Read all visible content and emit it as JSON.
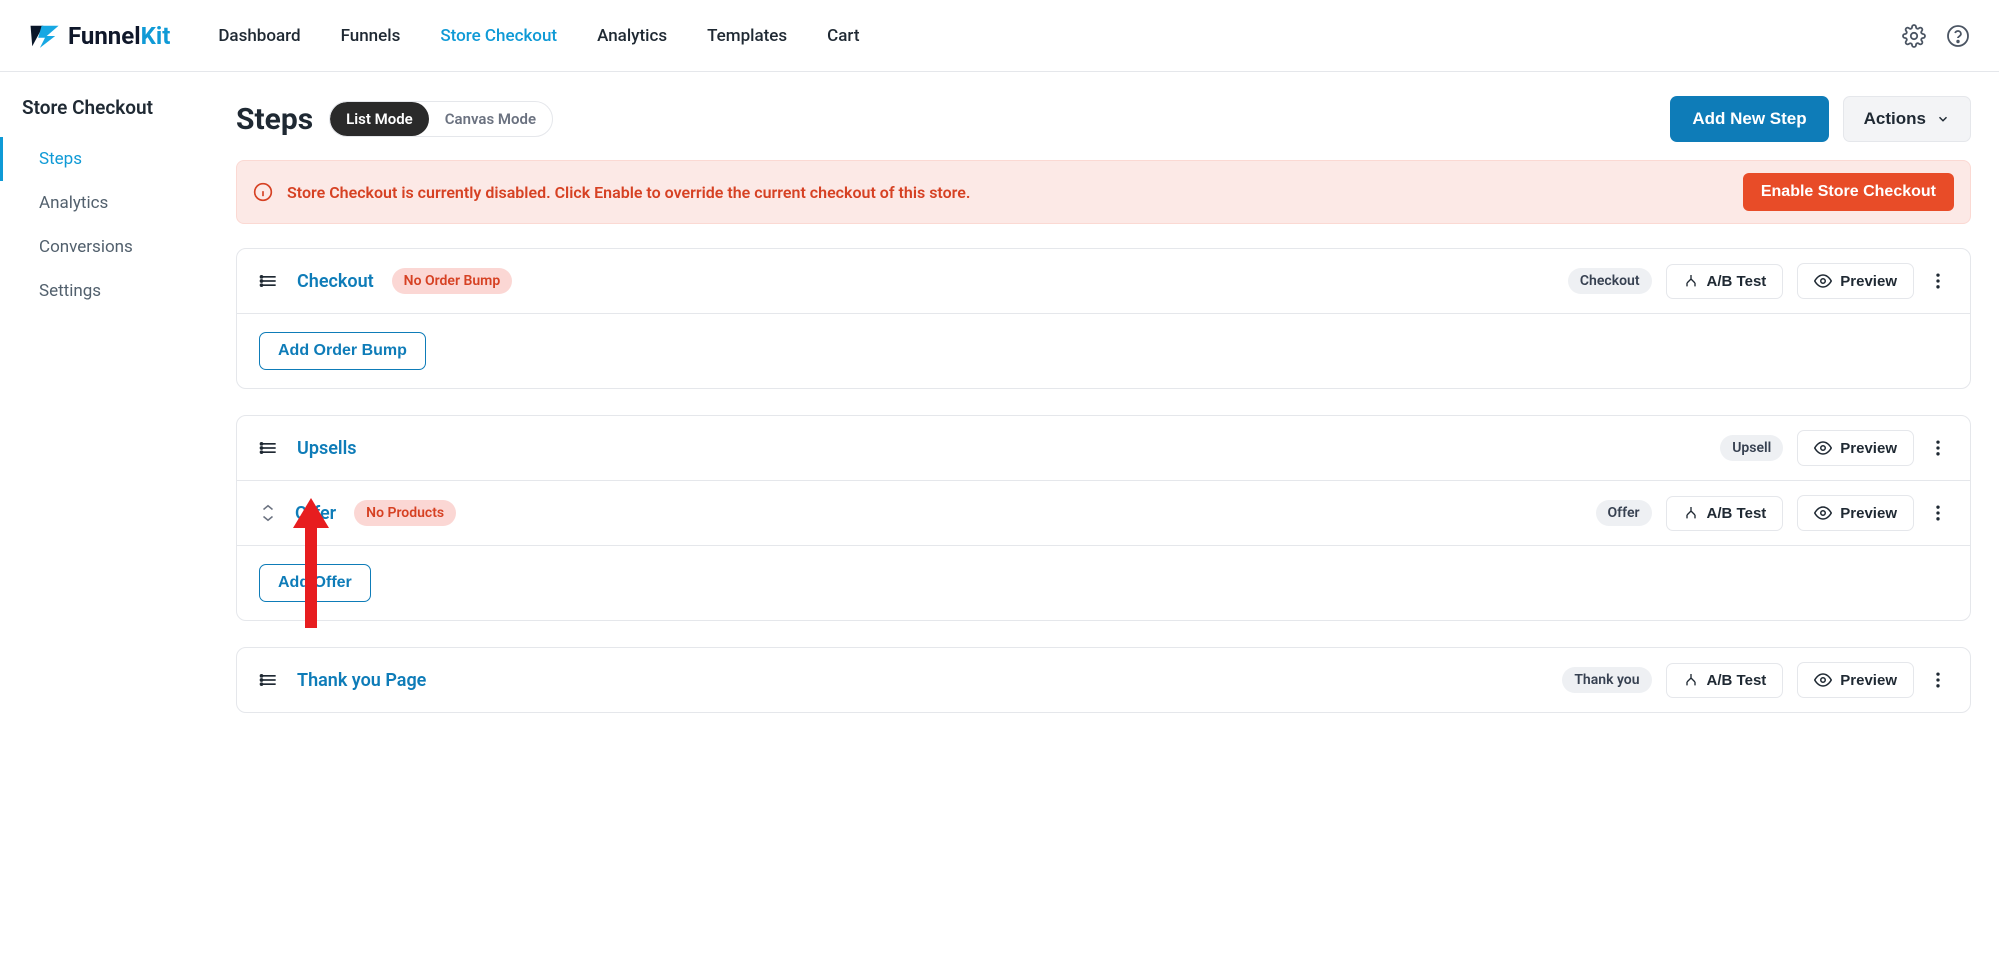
{
  "logo": {
    "prefix": "Funnel",
    "suffix": "Kit"
  },
  "topnav": {
    "dashboard": "Dashboard",
    "funnels": "Funnels",
    "storecheckout": "Store Checkout",
    "analytics": "Analytics",
    "templates": "Templates",
    "cart": "Cart"
  },
  "sidebar": {
    "title": "Store Checkout",
    "items": [
      "Steps",
      "Analytics",
      "Conversions",
      "Settings"
    ]
  },
  "page": {
    "title": "Steps",
    "mode_list": "List Mode",
    "mode_canvas": "Canvas Mode",
    "add_new_step": "Add New Step",
    "actions": "Actions"
  },
  "alert": {
    "text": "Store Checkout is currently disabled. Click Enable to override the current checkout of this store.",
    "button": "Enable Store Checkout"
  },
  "step1": {
    "name": "Checkout",
    "badge": "No Order Bump",
    "type_pill": "Checkout",
    "ab_test": "A/B Test",
    "preview": "Preview",
    "add_bump": "Add Order Bump"
  },
  "step2": {
    "name": "Upsells",
    "type_pill": "Upsell",
    "preview": "Preview",
    "offer_name": "Offer",
    "offer_badge": "No Products",
    "offer_pill": "Offer",
    "offer_ab_test": "A/B Test",
    "offer_preview": "Preview",
    "add_offer": "Add Offer"
  },
  "step3": {
    "name": "Thank you Page",
    "type_pill": "Thank you",
    "ab_test": "A/B Test",
    "preview": "Preview"
  }
}
